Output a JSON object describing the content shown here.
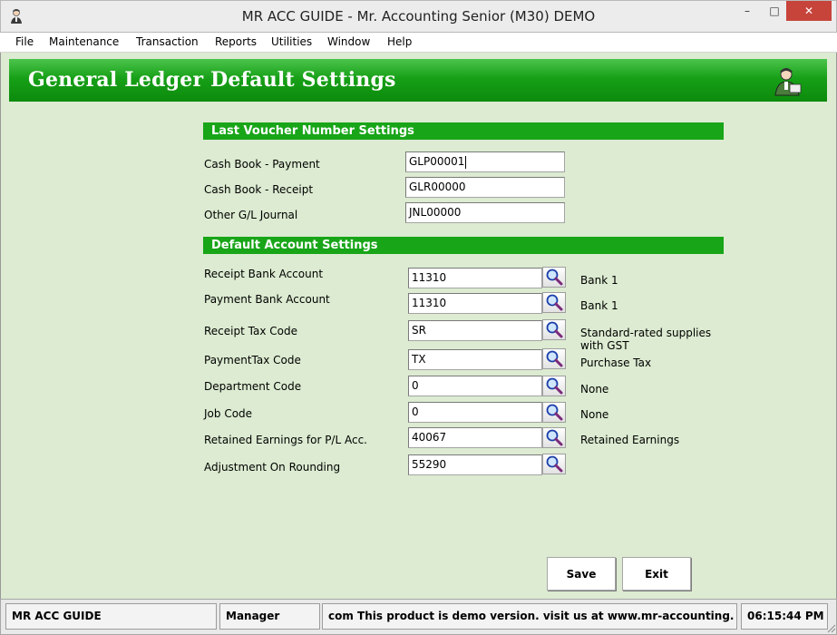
{
  "window": {
    "title": "MR ACC GUIDE - Mr. Accounting Senior (M30) DEMO",
    "min_glyph": "–",
    "max_glyph": "□",
    "close_glyph": "✕"
  },
  "menu": [
    {
      "label": "File"
    },
    {
      "label": "Maintenance"
    },
    {
      "label": "Transaction"
    },
    {
      "label": "Reports"
    },
    {
      "label": "Utilities"
    },
    {
      "label": "Window"
    },
    {
      "label": "Help"
    }
  ],
  "header": {
    "title": "General Ledger Default Settings",
    "icon": "user-icon"
  },
  "voucher_section": {
    "title": "Last Voucher Number Settings",
    "fields": [
      {
        "label": "Cash Book - Payment",
        "value": "GLP00001"
      },
      {
        "label": "Cash Book - Receipt",
        "value": "GLR00000"
      },
      {
        "label": "Other G/L Journal",
        "value": "JNL00000"
      }
    ]
  },
  "account_section": {
    "title": "Default Account Settings",
    "lookup_icon": "magnifier-icon",
    "fields": [
      {
        "label": "Receipt Bank Account",
        "value": "11310",
        "description": "Bank 1"
      },
      {
        "label": "Payment Bank Account",
        "value": "11310",
        "description": "Bank 1"
      },
      {
        "label": "Receipt Tax Code",
        "value": "SR",
        "description": "Standard-rated supplies\nwith GST"
      },
      {
        "label": "PaymentTax Code",
        "value": "TX",
        "description": "Purchase Tax"
      },
      {
        "label": "Department Code",
        "value": "0",
        "description": "None"
      },
      {
        "label": "Job Code",
        "value": "0",
        "description": "None"
      },
      {
        "label": "Retained Earnings for P/L Acc.",
        "value": "40067",
        "description": "Retained Earnings"
      },
      {
        "label": "Adjustment On Rounding",
        "value": "55290",
        "description": ""
      }
    ]
  },
  "buttons": {
    "save": "Save",
    "exit": "Exit"
  },
  "status": {
    "company": "MR ACC GUIDE",
    "user": "Manager",
    "message": "com This product is demo version.  visit us at www.mr-accounting.",
    "time": "06:15:44 PM"
  },
  "colors": {
    "header_green": "#17a017",
    "section_green": "#18a518",
    "panel_background": "#dcebd1",
    "close_red": "#c7443b"
  }
}
